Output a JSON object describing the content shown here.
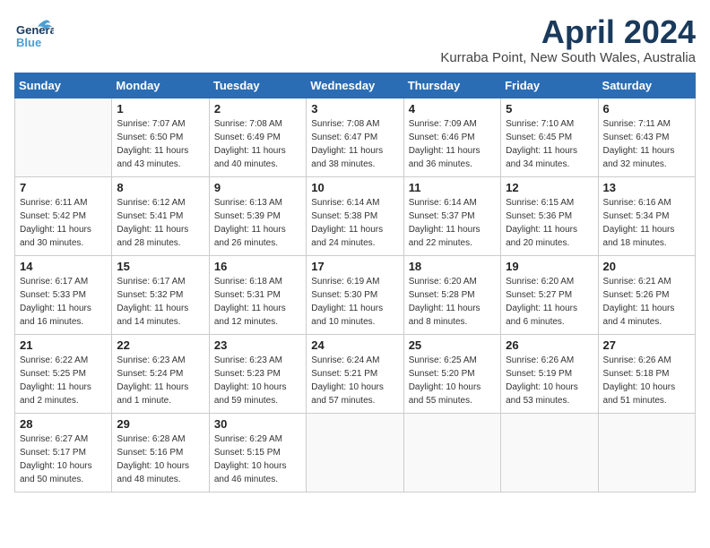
{
  "header": {
    "logo_general": "General",
    "logo_blue": "Blue",
    "month": "April 2024",
    "location": "Kurraba Point, New South Wales, Australia"
  },
  "weekdays": [
    "Sunday",
    "Monday",
    "Tuesday",
    "Wednesday",
    "Thursday",
    "Friday",
    "Saturday"
  ],
  "weeks": [
    [
      {
        "day": "",
        "info": ""
      },
      {
        "day": "1",
        "info": "Sunrise: 7:07 AM\nSunset: 6:50 PM\nDaylight: 11 hours\nand 43 minutes."
      },
      {
        "day": "2",
        "info": "Sunrise: 7:08 AM\nSunset: 6:49 PM\nDaylight: 11 hours\nand 40 minutes."
      },
      {
        "day": "3",
        "info": "Sunrise: 7:08 AM\nSunset: 6:47 PM\nDaylight: 11 hours\nand 38 minutes."
      },
      {
        "day": "4",
        "info": "Sunrise: 7:09 AM\nSunset: 6:46 PM\nDaylight: 11 hours\nand 36 minutes."
      },
      {
        "day": "5",
        "info": "Sunrise: 7:10 AM\nSunset: 6:45 PM\nDaylight: 11 hours\nand 34 minutes."
      },
      {
        "day": "6",
        "info": "Sunrise: 7:11 AM\nSunset: 6:43 PM\nDaylight: 11 hours\nand 32 minutes."
      }
    ],
    [
      {
        "day": "7",
        "info": "Sunrise: 6:11 AM\nSunset: 5:42 PM\nDaylight: 11 hours\nand 30 minutes."
      },
      {
        "day": "8",
        "info": "Sunrise: 6:12 AM\nSunset: 5:41 PM\nDaylight: 11 hours\nand 28 minutes."
      },
      {
        "day": "9",
        "info": "Sunrise: 6:13 AM\nSunset: 5:39 PM\nDaylight: 11 hours\nand 26 minutes."
      },
      {
        "day": "10",
        "info": "Sunrise: 6:14 AM\nSunset: 5:38 PM\nDaylight: 11 hours\nand 24 minutes."
      },
      {
        "day": "11",
        "info": "Sunrise: 6:14 AM\nSunset: 5:37 PM\nDaylight: 11 hours\nand 22 minutes."
      },
      {
        "day": "12",
        "info": "Sunrise: 6:15 AM\nSunset: 5:36 PM\nDaylight: 11 hours\nand 20 minutes."
      },
      {
        "day": "13",
        "info": "Sunrise: 6:16 AM\nSunset: 5:34 PM\nDaylight: 11 hours\nand 18 minutes."
      }
    ],
    [
      {
        "day": "14",
        "info": "Sunrise: 6:17 AM\nSunset: 5:33 PM\nDaylight: 11 hours\nand 16 minutes."
      },
      {
        "day": "15",
        "info": "Sunrise: 6:17 AM\nSunset: 5:32 PM\nDaylight: 11 hours\nand 14 minutes."
      },
      {
        "day": "16",
        "info": "Sunrise: 6:18 AM\nSunset: 5:31 PM\nDaylight: 11 hours\nand 12 minutes."
      },
      {
        "day": "17",
        "info": "Sunrise: 6:19 AM\nSunset: 5:30 PM\nDaylight: 11 hours\nand 10 minutes."
      },
      {
        "day": "18",
        "info": "Sunrise: 6:20 AM\nSunset: 5:28 PM\nDaylight: 11 hours\nand 8 minutes."
      },
      {
        "day": "19",
        "info": "Sunrise: 6:20 AM\nSunset: 5:27 PM\nDaylight: 11 hours\nand 6 minutes."
      },
      {
        "day": "20",
        "info": "Sunrise: 6:21 AM\nSunset: 5:26 PM\nDaylight: 11 hours\nand 4 minutes."
      }
    ],
    [
      {
        "day": "21",
        "info": "Sunrise: 6:22 AM\nSunset: 5:25 PM\nDaylight: 11 hours\nand 2 minutes."
      },
      {
        "day": "22",
        "info": "Sunrise: 6:23 AM\nSunset: 5:24 PM\nDaylight: 11 hours\nand 1 minute."
      },
      {
        "day": "23",
        "info": "Sunrise: 6:23 AM\nSunset: 5:23 PM\nDaylight: 10 hours\nand 59 minutes."
      },
      {
        "day": "24",
        "info": "Sunrise: 6:24 AM\nSunset: 5:21 PM\nDaylight: 10 hours\nand 57 minutes."
      },
      {
        "day": "25",
        "info": "Sunrise: 6:25 AM\nSunset: 5:20 PM\nDaylight: 10 hours\nand 55 minutes."
      },
      {
        "day": "26",
        "info": "Sunrise: 6:26 AM\nSunset: 5:19 PM\nDaylight: 10 hours\nand 53 minutes."
      },
      {
        "day": "27",
        "info": "Sunrise: 6:26 AM\nSunset: 5:18 PM\nDaylight: 10 hours\nand 51 minutes."
      }
    ],
    [
      {
        "day": "28",
        "info": "Sunrise: 6:27 AM\nSunset: 5:17 PM\nDaylight: 10 hours\nand 50 minutes."
      },
      {
        "day": "29",
        "info": "Sunrise: 6:28 AM\nSunset: 5:16 PM\nDaylight: 10 hours\nand 48 minutes."
      },
      {
        "day": "30",
        "info": "Sunrise: 6:29 AM\nSunset: 5:15 PM\nDaylight: 10 hours\nand 46 minutes."
      },
      {
        "day": "",
        "info": ""
      },
      {
        "day": "",
        "info": ""
      },
      {
        "day": "",
        "info": ""
      },
      {
        "day": "",
        "info": ""
      }
    ]
  ]
}
